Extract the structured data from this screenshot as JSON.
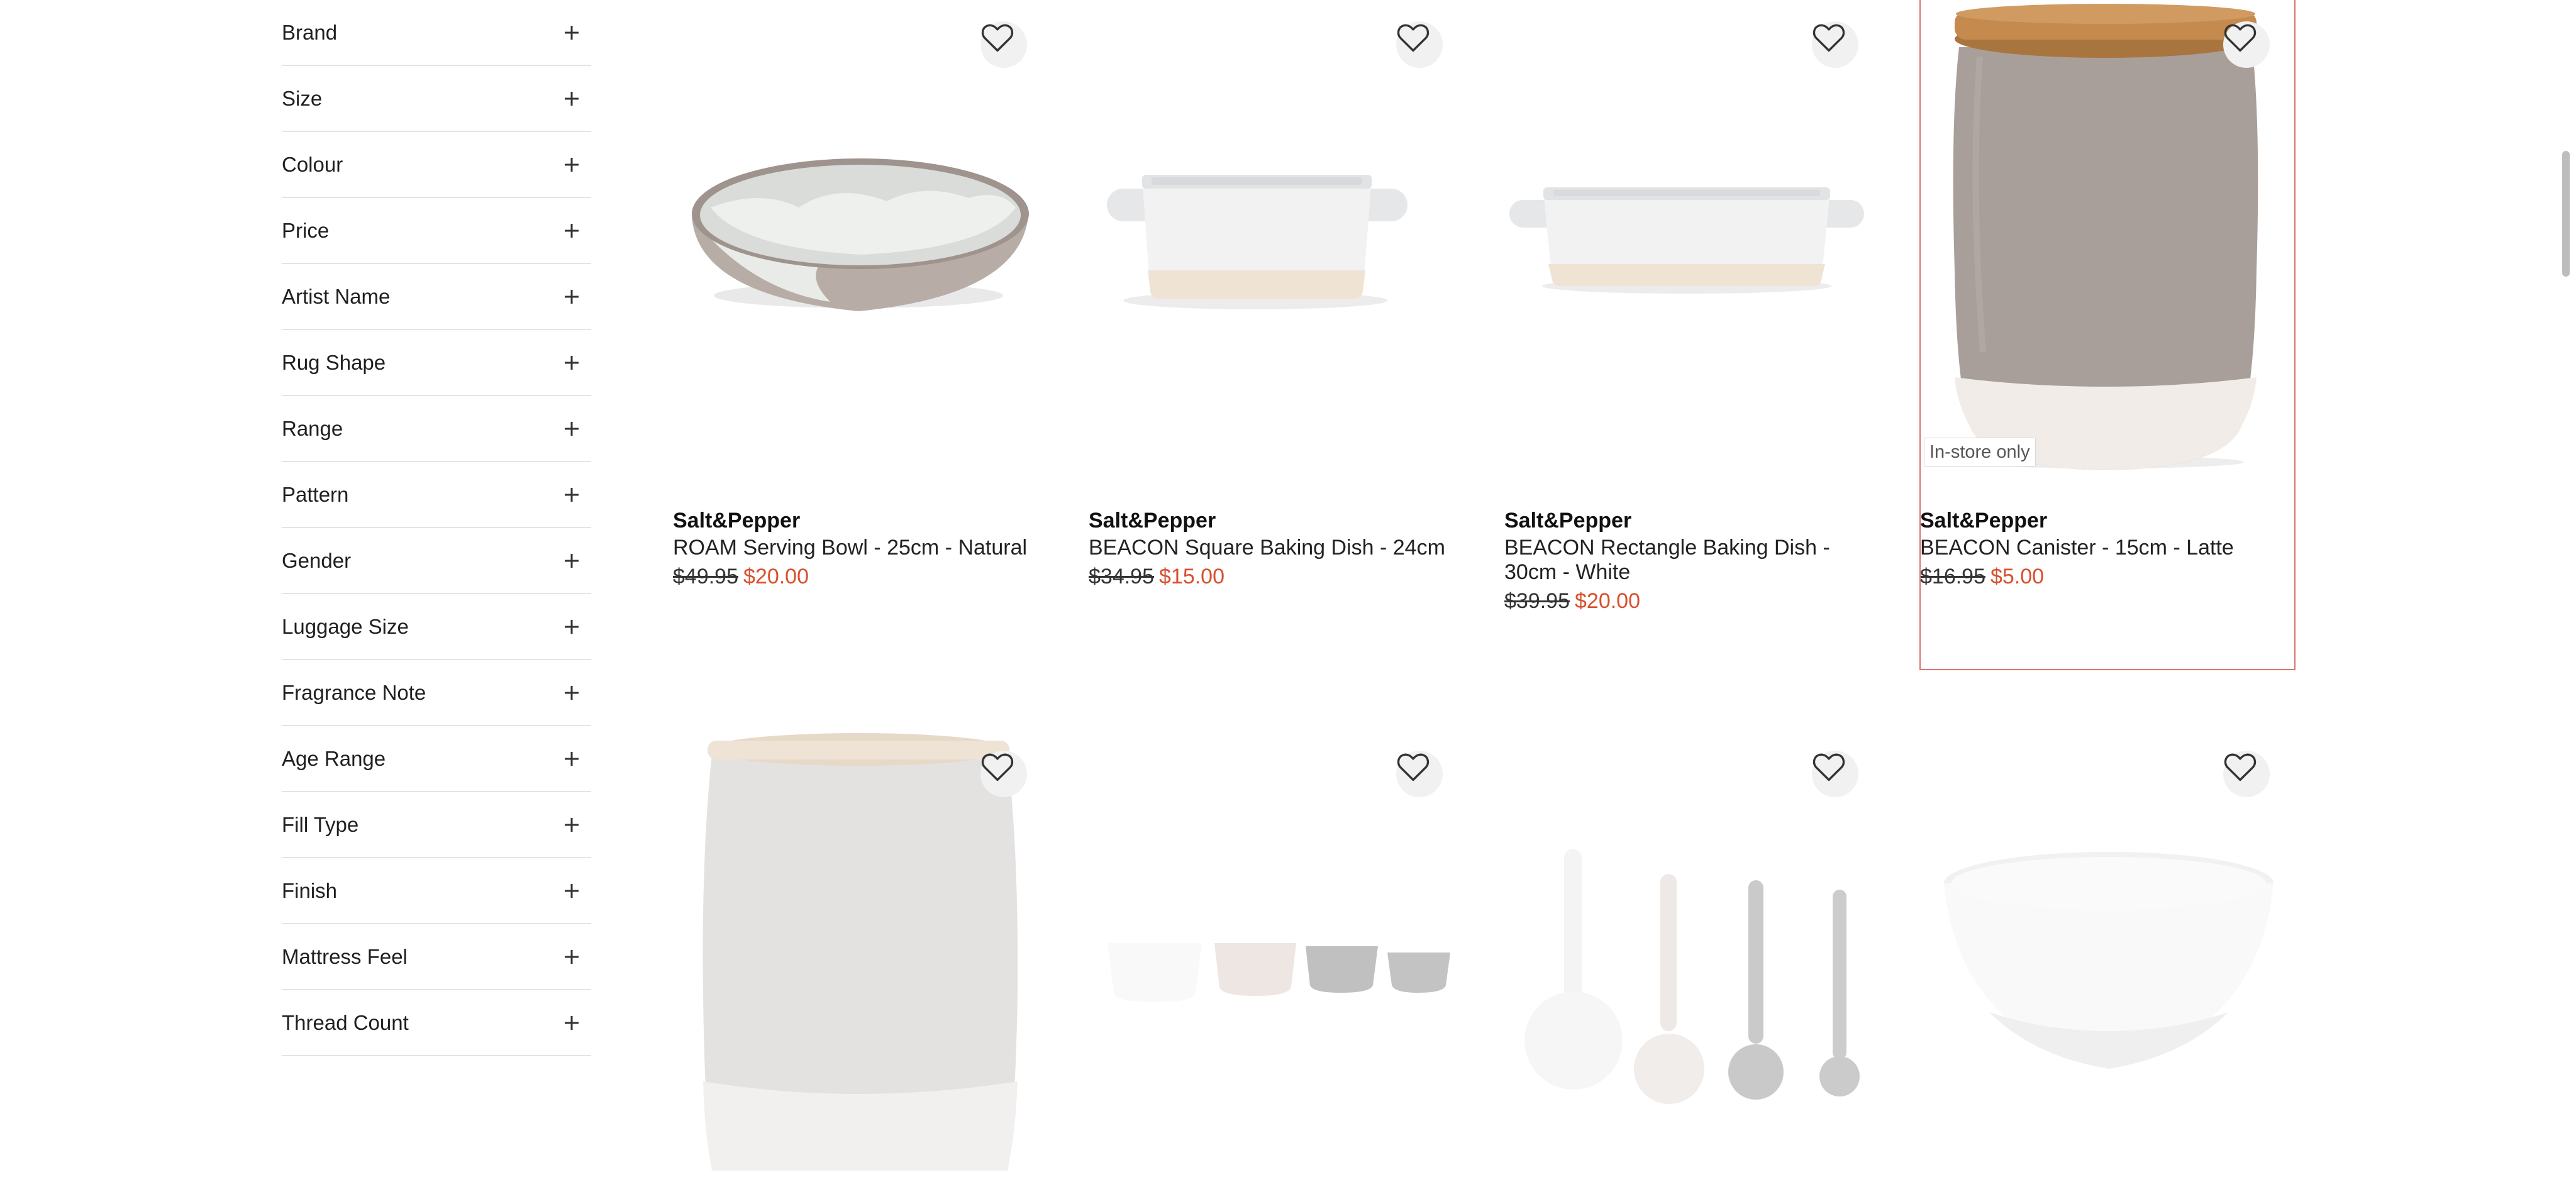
{
  "filters": [
    {
      "label": "Brand"
    },
    {
      "label": "Size"
    },
    {
      "label": "Colour"
    },
    {
      "label": "Price"
    },
    {
      "label": "Artist Name"
    },
    {
      "label": "Rug Shape"
    },
    {
      "label": "Range"
    },
    {
      "label": "Pattern"
    },
    {
      "label": "Gender"
    },
    {
      "label": "Luggage Size"
    },
    {
      "label": "Fragrance Note"
    },
    {
      "label": "Age Range"
    },
    {
      "label": "Fill Type"
    },
    {
      "label": "Finish"
    },
    {
      "label": "Mattress Feel"
    },
    {
      "label": "Thread Count"
    }
  ],
  "products": [
    {
      "brand": "Salt&Pepper",
      "name": "ROAM Serving Bowl - 25cm - Natural",
      "was": "$49.95",
      "now": "$20.00"
    },
    {
      "brand": "Salt&Pepper",
      "name": "BEACON Square Baking Dish - 24cm",
      "was": "$34.95",
      "now": "$15.00"
    },
    {
      "brand": "Salt&Pepper",
      "name": "BEACON Rectangle Baking Dish - 30cm - White",
      "was": "$39.95",
      "now": "$20.00"
    },
    {
      "brand": "Salt&Pepper",
      "name": "BEACON Canister - 15cm - Latte",
      "was": "$16.95",
      "now": "$5.00",
      "badge": "In-store only"
    }
  ],
  "icons": {
    "wishlist": "heart-outline-icon",
    "expand": "plus-icon"
  },
  "colors": {
    "sale_price": "#d94f2e",
    "selected_border": "#d8756b"
  }
}
